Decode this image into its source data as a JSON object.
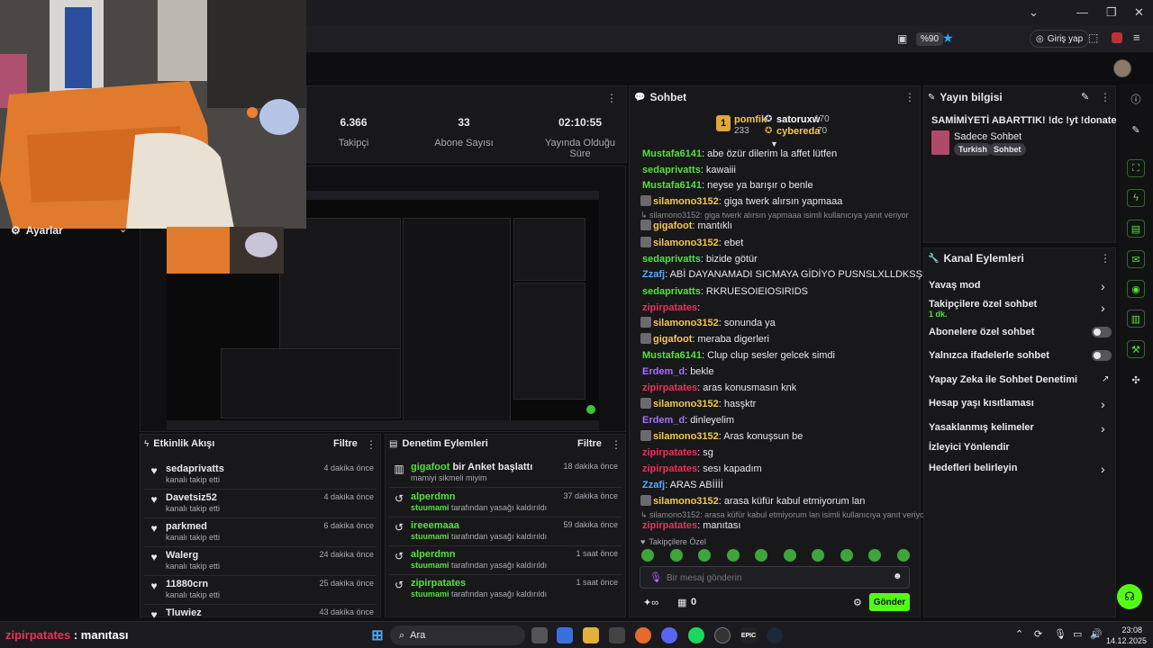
{
  "browser": {
    "zoom": "%90",
    "login": "Giriş yap"
  },
  "stats": [
    {
      "value": "6.366",
      "label": "Takipçi"
    },
    {
      "value": "33",
      "label": "Abone Sayısı"
    },
    {
      "value": "02:10:55",
      "label": "Yayında Olduğu Süre"
    }
  ],
  "settings_label": "Ayarlar",
  "chat": {
    "title": "Sohbet",
    "leaderboard": [
      {
        "rank": "1",
        "name": "pomfik",
        "score": "233"
      },
      {
        "name": "satoruxw",
        "score": "170"
      },
      {
        "name": "cybereda",
        "score": "70"
      }
    ],
    "messages": [
      {
        "user": "Mustafa6141",
        "text": ": abe özür dilerim la affet lütfen",
        "color": "#57e03c"
      },
      {
        "user": "sedaprivatts",
        "text": ": kawaiii",
        "color": "#57e03c"
      },
      {
        "user": "Mustafa6141",
        "text": ": neyse ya barışır o benle",
        "color": "#57e03c"
      },
      {
        "user": "silamono3152",
        "text": ": giga twerk alırsın yapmaaa",
        "color": "#f5c84c"
      },
      {
        "reply": "silamono3152: giga twerk alırsın yapmaaa isimli kullanıcıya yanıt veriyor"
      },
      {
        "user": "gigafoot",
        "text": ": mantıklı",
        "color": "#f5c84c"
      },
      {
        "user": "silamono3152",
        "text": ": ebet",
        "color": "#f5c84c"
      },
      {
        "user": "sedaprivatts",
        "text": ": bizide götür",
        "color": "#57e03c"
      },
      {
        "user": "Zzafj",
        "text": ": ABİ DAYANAMADI SICMAYA GİDİYO PUSNSLXLLDKSŞDKXJC",
        "color": "#5aa8ff"
      },
      {
        "user": "sedaprivatts",
        "text": ": RKRUESOIEIOSIRIDS",
        "color": "#57e03c"
      },
      {
        "user": "zipirpatates",
        "text": ":",
        "color": "#e8335a"
      },
      {
        "user": "silamono3152",
        "text": ": sonunda ya",
        "color": "#f5c84c"
      },
      {
        "user": "gigafoot",
        "text": ": meraba digerleri",
        "color": "#f5c84c"
      },
      {
        "user": "Mustafa6141",
        "text": ": Clup clup sesler gelcek simdi",
        "color": "#57e03c"
      },
      {
        "user": "Erdem_d",
        "text": ": bekle",
        "color": "#a970ff"
      },
      {
        "user": "zipirpatates",
        "text": ": aras konusmasın knk",
        "color": "#e8335a"
      },
      {
        "user": "silamono3152",
        "text": ": hasşktr",
        "color": "#f5c84c"
      },
      {
        "user": "Erdem_d",
        "text": ": dinleyelim",
        "color": "#a970ff"
      },
      {
        "user": "silamono3152",
        "text": ": Aras konuşsun be",
        "color": "#f5c84c"
      },
      {
        "user": "zipirpatates",
        "text": ": sg",
        "color": "#e8335a"
      },
      {
        "user": "zipirpatates",
        "text": ": sesı kapadım",
        "color": "#e8335a"
      },
      {
        "user": "Zzafj",
        "text": ": ARAS ABİİİİ",
        "color": "#5aa8ff"
      },
      {
        "user": "silamono3152",
        "text": ": arasa küfür kabul etmiyorum lan",
        "color": "#f5c84c"
      },
      {
        "reply": "silamono3152: arasa küfür kabul etmiyorum lan isimli kullanıcıya yanıt veriyor"
      },
      {
        "user": "zipirpatates",
        "text": ": manıtası",
        "color": "#e8335a"
      }
    ],
    "followers_only": "Takipçilere Özel",
    "input_placeholder": "Bir mesaj gönderin",
    "points": "0",
    "send": "Gönder"
  },
  "stream_info": {
    "title": "Yayın bilgisi",
    "stream_title": "SAMİMİYETİ ABARTTIK! !dc !yt !donate",
    "category": "Sadece Sohbet",
    "tags": [
      "Turkish",
      "Sohbet"
    ]
  },
  "channel_actions": {
    "title": "Kanal Eylemleri",
    "items": [
      {
        "label": "Yavaş mod",
        "extra": "",
        "control": "chevron"
      },
      {
        "label": "Takipçilere özel sohbet",
        "extra": "1 dk.",
        "control": "chevron"
      },
      {
        "label": "Abonelere özel sohbet",
        "extra": "",
        "control": "toggle"
      },
      {
        "label": "Yalnızca ifadelerle sohbet",
        "extra": "",
        "control": "toggle"
      },
      {
        "label": "Yapay Zeka ile Sohbet Denetimi",
        "extra": "",
        "control": "external"
      },
      {
        "label": "Hesap yaşı kısıtlaması",
        "extra": "",
        "control": "chevron"
      },
      {
        "label": "Yasaklanmış kelimeler",
        "extra": "",
        "control": "chevron"
      },
      {
        "label": "İzleyici Yönlendir",
        "extra": "",
        "control": "none"
      },
      {
        "label": "Hedefleri belirleyin",
        "extra": "",
        "control": "chevron"
      }
    ]
  },
  "activity": {
    "title": "Etkinlik Akışı",
    "filter": "Filtre",
    "items": [
      {
        "name": "sedaprivatts",
        "sub": "kanalı takip etti",
        "time": "4 dakika önce"
      },
      {
        "name": "Davetsiz52",
        "sub": "kanalı takip etti",
        "time": "4 dakika önce"
      },
      {
        "name": "parkmed",
        "sub": "kanalı takip etti",
        "time": "6 dakika önce"
      },
      {
        "name": "Walerg",
        "sub": "kanalı takip etti",
        "time": "24 dakika önce"
      },
      {
        "name": "11880crn",
        "sub": "kanalı takip etti",
        "time": "25 dakika önce"
      },
      {
        "name": "Tluwiez",
        "sub": "",
        "time": "43 dakika önce"
      }
    ]
  },
  "moderation": {
    "title": "Denetim Eylemleri",
    "filter": "Filtre",
    "items": [
      {
        "name": "gigafoot",
        "action": " bir Anket başlattı",
        "sub_user": "",
        "sub": "mamiyi sikmeli miyim",
        "time": "18 dakika önce",
        "icon": "poll"
      },
      {
        "name": "alperdmn",
        "action": "",
        "sub_user": "stuumami",
        "sub": " tarafından yasağı kaldırıldı",
        "time": "37 dakika önce",
        "icon": "undo"
      },
      {
        "name": "ireeemaaa",
        "action": "",
        "sub_user": "stuumami",
        "sub": " tarafından yasağı kaldırıldı",
        "time": "59 dakika önce",
        "icon": "undo"
      },
      {
        "name": "alperdmn",
        "action": "",
        "sub_user": "stuumami",
        "sub": " tarafından yasağı kaldırıldı",
        "time": "1 saat önce",
        "icon": "undo"
      },
      {
        "name": "zipirpatates",
        "action": "",
        "sub_user": "stuumami",
        "sub": " tarafından yasağı kaldırıldı",
        "time": "1 saat önce",
        "icon": "undo"
      }
    ]
  },
  "overlay": {
    "user": "zipirpatates",
    "text": " : manıtası"
  },
  "taskbar": {
    "search": "Ara",
    "time": "23:08",
    "date": "14.12.2025"
  }
}
